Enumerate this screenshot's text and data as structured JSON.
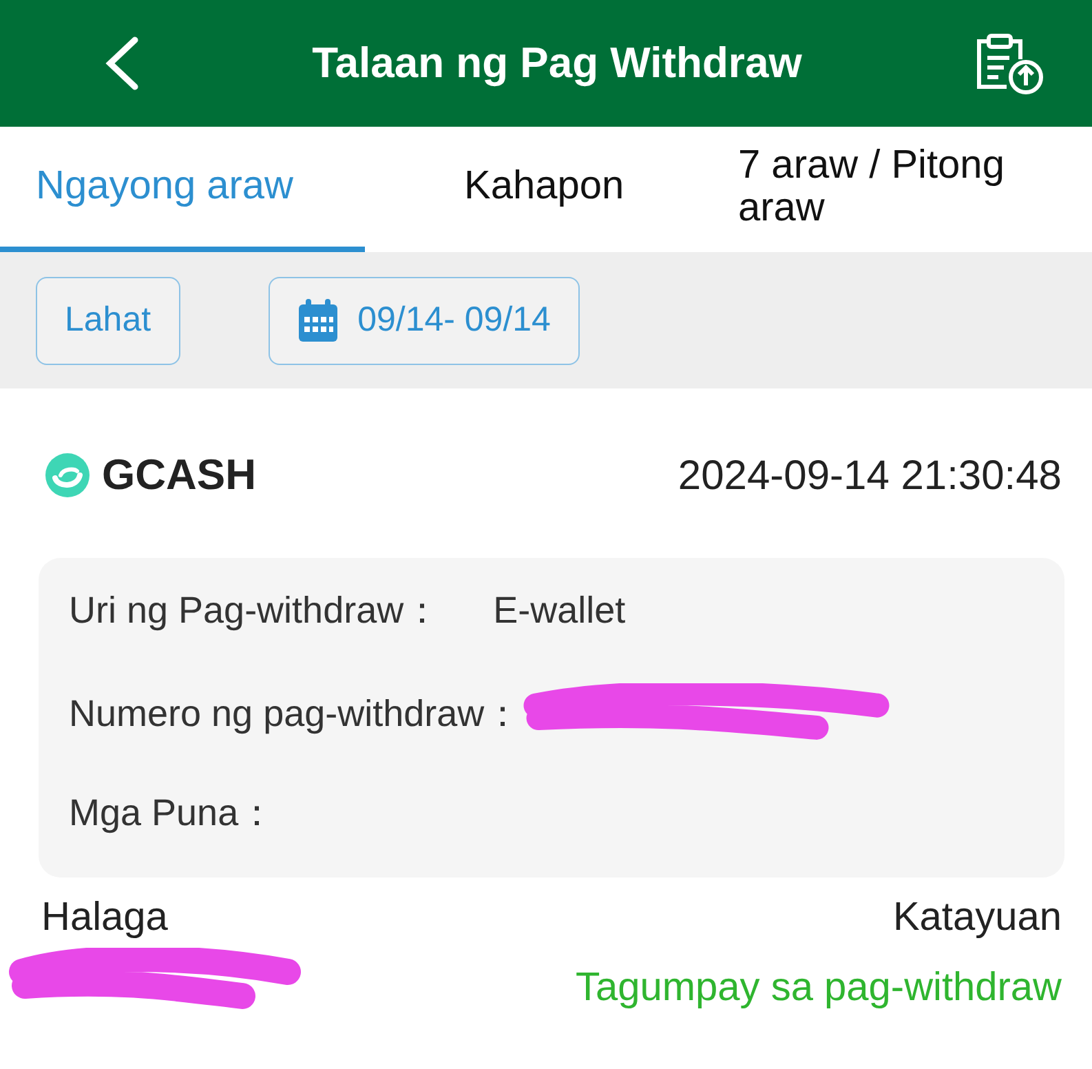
{
  "header": {
    "title": "Talaan ng Pag Withdraw"
  },
  "tabs": [
    {
      "label": "Ngayong araw",
      "selected": true
    },
    {
      "label": "Kahapon",
      "selected": false
    },
    {
      "label": "7 araw / Pitong araw",
      "selected": false
    }
  ],
  "filters": [
    {
      "kind": "plain",
      "label": "Lahat"
    },
    {
      "kind": "date",
      "label": "09/14- 09/14"
    }
  ],
  "record": {
    "method": "GCASH",
    "time": "2024-09-14 21:30:48",
    "details": [
      {
        "label": "Uri ng Pag-withdraw：",
        "value": "E-wallet",
        "redacted": false
      },
      {
        "label": "Numero ng pag-withdraw：",
        "redacted": true
      },
      {
        "label": "Mga Puna：",
        "redacted": false
      }
    ],
    "amount": {
      "label": "Halaga",
      "redacted": true
    },
    "status": {
      "label": "Katayuan",
      "value": "Tagumpay sa pag-withdraw"
    }
  }
}
